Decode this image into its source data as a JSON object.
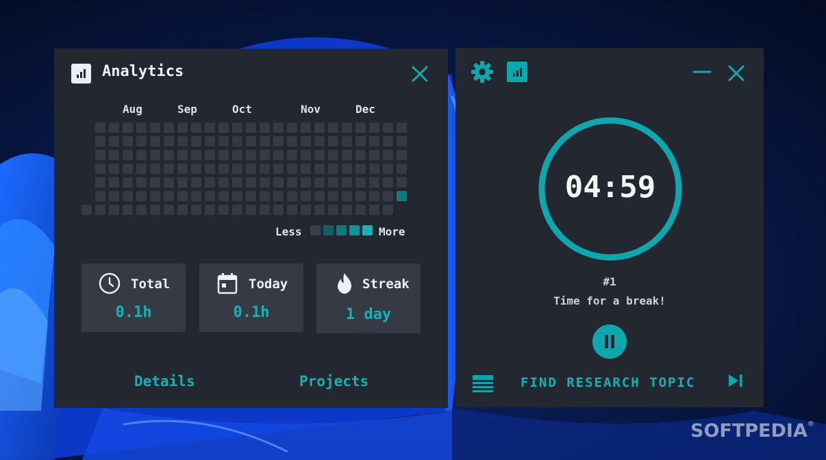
{
  "analytics": {
    "title": "Analytics",
    "months": [
      "Aug",
      "Sep",
      "Oct",
      "Nov",
      "Dec"
    ],
    "heatmap": {
      "weeks": 23,
      "days_per_week": 7,
      "active_cells": [
        {
          "week": 22,
          "day": 5,
          "level": 2
        }
      ]
    },
    "legend": {
      "less_label": "Less",
      "more_label": "More",
      "colors": [
        "#3a3f48",
        "#155e63",
        "#0f7b81",
        "#0e949b",
        "#13b2b8"
      ]
    },
    "stats": [
      {
        "icon": "clock-icon",
        "label": "Total",
        "value": "0.1h"
      },
      {
        "icon": "calendar-icon",
        "label": "Today",
        "value": "0.1h"
      },
      {
        "icon": "flame-icon",
        "label": "Streak",
        "value": "1 day"
      }
    ],
    "links": {
      "details": "Details",
      "projects": "Projects"
    }
  },
  "timer": {
    "time": "04:59",
    "session": "#1",
    "status": "Time for a break!",
    "task": "FIND RESEARCH TOPIC",
    "progress": 1.0,
    "accent": "#0ea7ae"
  },
  "watermark": {
    "text": "SOFTPEDIA",
    "mark": "®"
  }
}
